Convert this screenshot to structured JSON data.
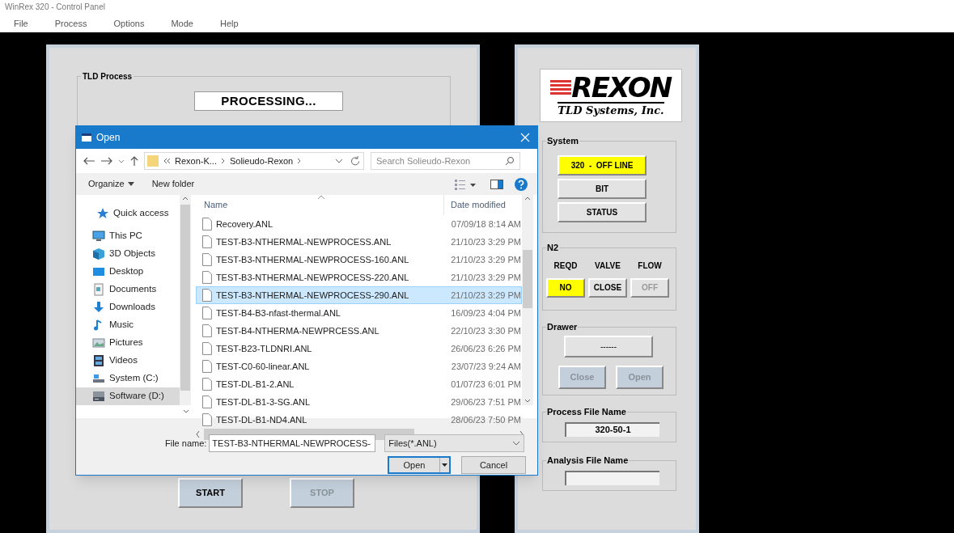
{
  "window": {
    "title": "WinRex  320 - Control Panel"
  },
  "menu": [
    "File",
    "Process",
    "Options",
    "Mode",
    "Help"
  ],
  "process_panel": {
    "group_title": "TLD Process",
    "status": "PROCESSING...",
    "buttons": [
      {
        "label": "START",
        "disabled": false
      },
      {
        "label": "STOP",
        "disabled": true
      }
    ]
  },
  "right_panel": {
    "logo": {
      "word": "REXON",
      "tagline": "TLD Systems, Inc."
    },
    "system": {
      "title": "System",
      "buttons": [
        {
          "label": "320  -  OFF LINE",
          "highlighted": true
        },
        {
          "label": "BIT",
          "highlighted": false
        },
        {
          "label": "STATUS",
          "highlighted": false
        }
      ]
    },
    "n2": {
      "title": "N2",
      "columns": [
        {
          "heading": "REQD",
          "value": "NO",
          "highlighted": true,
          "disabled": false
        },
        {
          "heading": "VALVE",
          "value": "CLOSE",
          "highlighted": false,
          "disabled": false
        },
        {
          "heading": "FLOW",
          "value": "OFF",
          "highlighted": false,
          "disabled": true
        }
      ]
    },
    "drawer": {
      "title": "Drawer",
      "display": "------",
      "buttons": [
        {
          "label": "Close",
          "disabled": true
        },
        {
          "label": "Open",
          "disabled": true
        }
      ]
    },
    "process_file": {
      "title": "Process File Name",
      "value": "320-50-1"
    },
    "analysis_file": {
      "title": "Analysis File Name"
    }
  },
  "dialog": {
    "title": "Open",
    "breadcrumb": [
      "Rexon-K...",
      "Solieudo-Rexon"
    ],
    "search": {
      "placeholder": "Search Solieudo-Rexon"
    },
    "toolbar": [
      "Organize",
      "New folder"
    ],
    "nav": [
      {
        "label": "Quick access",
        "selected": false
      },
      {
        "label": "This PC",
        "selected": false
      },
      {
        "label": "3D Objects",
        "selected": false
      },
      {
        "label": "Desktop",
        "selected": false
      },
      {
        "label": "Documents",
        "selected": false
      },
      {
        "label": "Downloads",
        "selected": false
      },
      {
        "label": "Music",
        "selected": false
      },
      {
        "label": "Pictures",
        "selected": false
      },
      {
        "label": "Videos",
        "selected": false
      },
      {
        "label": "System (C:)",
        "selected": false
      },
      {
        "label": "Software (D:)",
        "selected": true
      }
    ],
    "columns": [
      "Name",
      "Date modified"
    ],
    "files": [
      {
        "name": "Recovery.ANL",
        "date": "07/09/18 8:14 AM",
        "selected": false
      },
      {
        "name": "TEST-B3-NTHERMAL-NEWPROCESS.ANL",
        "date": "21/10/23 3:29 PM",
        "selected": false
      },
      {
        "name": "TEST-B3-NTHERMAL-NEWPROCESS-160.ANL",
        "date": "21/10/23 3:29 PM",
        "selected": false
      },
      {
        "name": "TEST-B3-NTHERMAL-NEWPROCESS-220.ANL",
        "date": "21/10/23 3:29 PM",
        "selected": false
      },
      {
        "name": "TEST-B3-NTHERMAL-NEWPROCESS-290.ANL",
        "date": "21/10/23 3:29 PM",
        "selected": true
      },
      {
        "name": "TEST-B4-B3-nfast-thermal.ANL",
        "date": "16/09/23 4:04 PM",
        "selected": false
      },
      {
        "name": "TEST-B4-NTHERMA-NEWPRCESS.ANL",
        "date": "22/10/23 3:30 PM",
        "selected": false
      },
      {
        "name": "TEST-B23-TLDNRI.ANL",
        "date": "26/06/23 6:26 PM",
        "selected": false
      },
      {
        "name": "TEST-C0-60-linear.ANL",
        "date": "23/07/23 9:24 AM",
        "selected": false
      },
      {
        "name": "TEST-DL-B1-2.ANL",
        "date": "01/07/23 6:01 PM",
        "selected": false
      },
      {
        "name": "TEST-DL-B1-3-SG.ANL",
        "date": "29/06/23 7:51 PM",
        "selected": false
      },
      {
        "name": "TEST-DL-B1-ND4.ANL",
        "date": "28/06/23 7:50 PM",
        "selected": false
      }
    ],
    "file_name": {
      "label": "File name:",
      "value": "TEST-B3-NTHERMAL-NEWPROCESS-"
    },
    "filter": "Files(*.ANL)",
    "buttons": [
      "Open",
      "Cancel"
    ]
  }
}
